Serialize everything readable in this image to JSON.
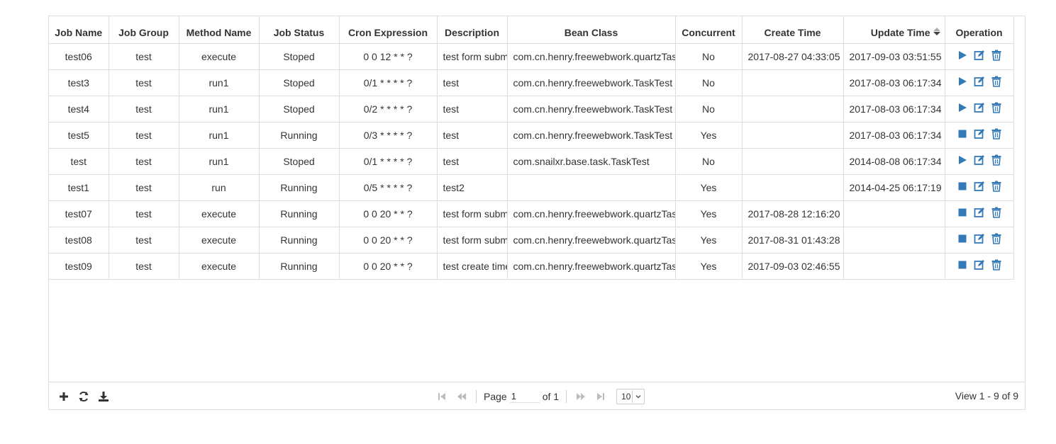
{
  "columns": [
    "Job Name",
    "Job Group",
    "Method Name",
    "Job Status",
    "Cron Expression",
    "Description",
    "Bean Class",
    "Concurrent",
    "Create Time",
    "Update Time",
    "Operation"
  ],
  "rows": [
    {
      "name": "test06",
      "group": "test",
      "method": "execute",
      "status": "Stoped",
      "cron": "0 0 12 * * ?",
      "desc": "test form submit",
      "bean": "com.cn.henry.freewebwork.quartzTask",
      "concurrent": "No",
      "create": "2017-08-27 04:33:05",
      "update": "2017-09-03 03:51:55",
      "running": false
    },
    {
      "name": "test3",
      "group": "test",
      "method": "run1",
      "status": "Stoped",
      "cron": "0/1 * * * * ?",
      "desc": "test",
      "bean": "com.cn.henry.freewebwork.TaskTest",
      "concurrent": "No",
      "create": "",
      "update": "2017-08-03 06:17:34",
      "running": false
    },
    {
      "name": "test4",
      "group": "test",
      "method": "run1",
      "status": "Stoped",
      "cron": "0/2 * * * * ?",
      "desc": "test",
      "bean": "com.cn.henry.freewebwork.TaskTest",
      "concurrent": "No",
      "create": "",
      "update": "2017-08-03 06:17:34",
      "running": false
    },
    {
      "name": "test5",
      "group": "test",
      "method": "run1",
      "status": "Running",
      "cron": "0/3 * * * * ?",
      "desc": "test",
      "bean": "com.cn.henry.freewebwork.TaskTest",
      "concurrent": "Yes",
      "create": "",
      "update": "2017-08-03 06:17:34",
      "running": true
    },
    {
      "name": "test",
      "group": "test",
      "method": "run1",
      "status": "Stoped",
      "cron": "0/1 * * * * ?",
      "desc": "test",
      "bean": "com.snailxr.base.task.TaskTest",
      "concurrent": "No",
      "create": "",
      "update": "2014-08-08 06:17:34",
      "running": false
    },
    {
      "name": "test1",
      "group": "test",
      "method": "run",
      "status": "Running",
      "cron": "0/5 * * * * ?",
      "desc": "test2",
      "bean": "",
      "concurrent": "Yes",
      "create": "",
      "update": "2014-04-25 06:17:19",
      "running": true
    },
    {
      "name": "test07",
      "group": "test",
      "method": "execute",
      "status": "Running",
      "cron": "0 0 20 * * ?",
      "desc": "test form submit",
      "bean": "com.cn.henry.freewebwork.quartzTask",
      "concurrent": "Yes",
      "create": "2017-08-28 12:16:20",
      "update": "",
      "running": true
    },
    {
      "name": "test08",
      "group": "test",
      "method": "execute",
      "status": "Running",
      "cron": "0 0 20 * * ?",
      "desc": "test form submit",
      "bean": "com.cn.henry.freewebwork.quartzTask",
      "concurrent": "Yes",
      "create": "2017-08-31 01:43:28",
      "update": "",
      "running": true
    },
    {
      "name": "test09",
      "group": "test",
      "method": "execute",
      "status": "Running",
      "cron": "0 0 20 * * ?",
      "desc": "test create time",
      "bean": "com.cn.henry.freewebwork.quartzTask",
      "concurrent": "Yes",
      "create": "2017-09-03 02:46:55",
      "update": "",
      "running": true
    }
  ],
  "pager": {
    "page_label": "Page",
    "page_value": "1",
    "of_label": "of 1",
    "rows_per_page": "10",
    "view_text": "View 1 - 9 of 9"
  },
  "colors": {
    "accent": "#337ab7",
    "border": "#dddddd"
  },
  "icons": {
    "start": "play-icon",
    "stop": "stop-icon",
    "edit": "edit-icon",
    "delete": "trash-icon",
    "add": "plus-icon",
    "refresh": "refresh-icon",
    "export": "download-icon"
  }
}
